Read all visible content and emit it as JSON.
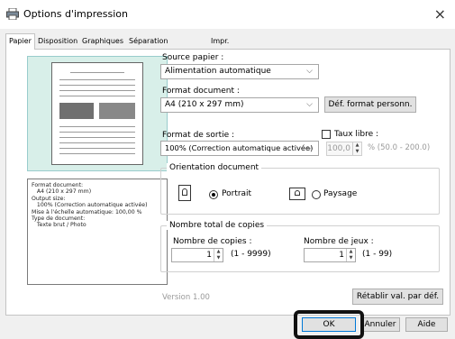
{
  "window": {
    "title": "Options d'impression",
    "app_icon": "printer-icon",
    "close_glyph": "×"
  },
  "tabs": [
    {
      "label": "Papier",
      "active": true
    },
    {
      "label": "Disposition",
      "active": false
    },
    {
      "label": "Graphiques",
      "active": false
    },
    {
      "label": "Séparation des couleurs",
      "active": false
    },
    {
      "label": "Impr. vers fichier",
      "active": false
    }
  ],
  "info_box": {
    "lines": [
      "Format document:",
      "   A4 (210 x 297 mm)",
      "Output size:",
      "   100% (Correction automatique activée)",
      "Mise à l'échelle automatique: 100,00 %",
      "Type de document:",
      "   Texte brut / Photo"
    ]
  },
  "paper_source": {
    "label": "Source papier :",
    "value": "Alimentation automatique"
  },
  "doc_format": {
    "label": "Format document :",
    "value": "A4 (210 x 297 mm)",
    "custom_button": "Déf. format personn."
  },
  "output_format": {
    "label": "Format de sortie :",
    "value": "100% (Correction automatique activée)",
    "free_ratio_label": "Taux libre :",
    "free_ratio_checked": false,
    "free_ratio_value": "100,0",
    "free_ratio_range": "% (50.0 - 200.0)"
  },
  "orientation": {
    "title": "Orientation document",
    "portrait_label": "Portrait",
    "landscape_label": "Paysage",
    "selected": "Portrait"
  },
  "copies": {
    "title": "Nombre total de copies",
    "copies_label": "Nombre de copies :",
    "copies_value": "1",
    "copies_range": "(1 - 9999)",
    "sets_label": "Nombre de jeux :",
    "sets_value": "1",
    "sets_range": "(1 - 99)"
  },
  "version": "Version 1.00",
  "reset_button": "Rétablir val. par déf.",
  "footer": {
    "ok": "OK",
    "cancel": "Annuler",
    "help": "Aide"
  }
}
